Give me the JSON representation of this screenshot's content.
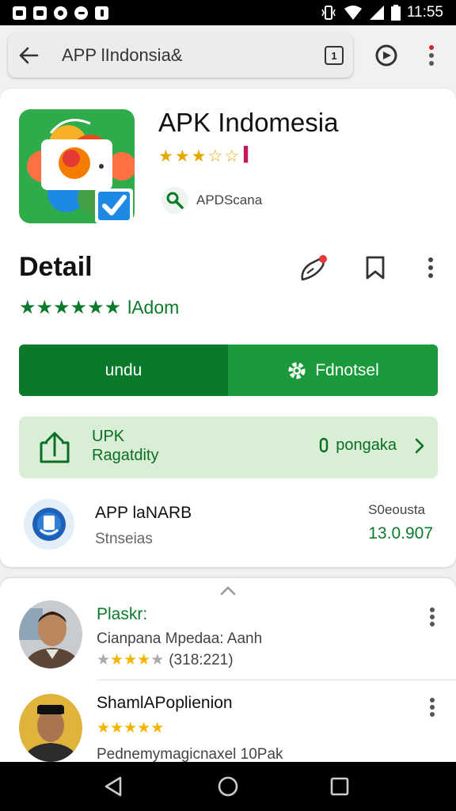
{
  "status_bar": {
    "time": "11:55",
    "left_icons": [
      "image-notification-icon",
      "message-notification-icon",
      "face-notification-icon",
      "photos-notification-icon",
      "download-notification-icon"
    ],
    "right_icons": [
      "vibrate-icon",
      "wifi-icon",
      "signal-icon",
      "battery-icon"
    ]
  },
  "browser": {
    "search_text": "APP lIndonsia&",
    "tab_count": "1"
  },
  "app": {
    "title": "APK Indomesia",
    "rating_stars": 3,
    "publisher": "APDScana"
  },
  "detail": {
    "heading": "Detail",
    "star_count": 6,
    "rating_label": "lAdom"
  },
  "buttons": {
    "download_label": "undu",
    "install_label": "Fdnotsel"
  },
  "info_card": {
    "line1": "UPK",
    "line2": "Ragatdity",
    "action_label": "pongaka"
  },
  "vendor": {
    "name": "APP laNARB",
    "subtitle": "Stnseias",
    "meta_label": "S0eousta",
    "meta_value": "13.0.907"
  },
  "reviews": [
    {
      "name": "Plaskr:",
      "text": "Cianpana Mpedaa: Aanh",
      "stars": 4,
      "count": "(318:221)"
    },
    {
      "name": "ShamlAPoplienion",
      "stars": 5,
      "text": "Pednemymagicnaxel 10Pak"
    }
  ],
  "colors": {
    "brand_green": "#0c7a2b",
    "button_dark": "#0a7a2a",
    "button_light": "#1a9a3a",
    "info_bg": "#d8efd6",
    "star_gold": "#f4b400"
  }
}
